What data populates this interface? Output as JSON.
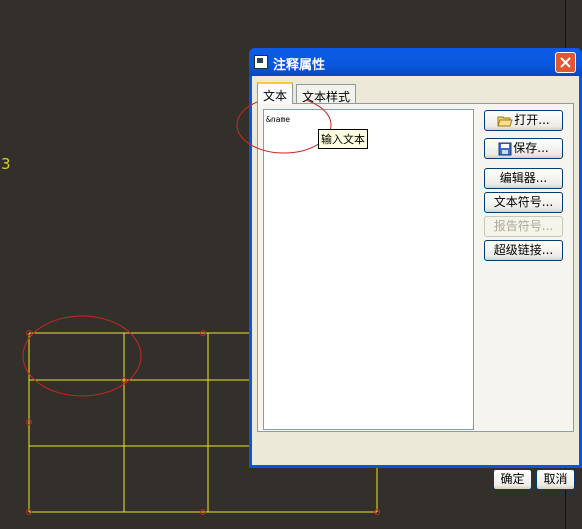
{
  "canvas": {
    "number_label": "3"
  },
  "dialog": {
    "title": "注释属性",
    "tabs": [
      {
        "label": "文本"
      },
      {
        "label": "文本样式"
      }
    ],
    "text_content": "&name",
    "tooltip": "输入文本",
    "buttons": {
      "open": "打开...",
      "save": "保存...",
      "editor": "编辑器...",
      "text_symbol": "文本符号...",
      "report_symbol": "报告符号...",
      "hyperlink": "超级链接..."
    },
    "ok": "确定",
    "cancel": "取消"
  },
  "colors": {
    "canvas_bg": "#33302c",
    "line": "#e8e62a",
    "marker": "#c8281e",
    "titlebar": "#0a58dc"
  }
}
